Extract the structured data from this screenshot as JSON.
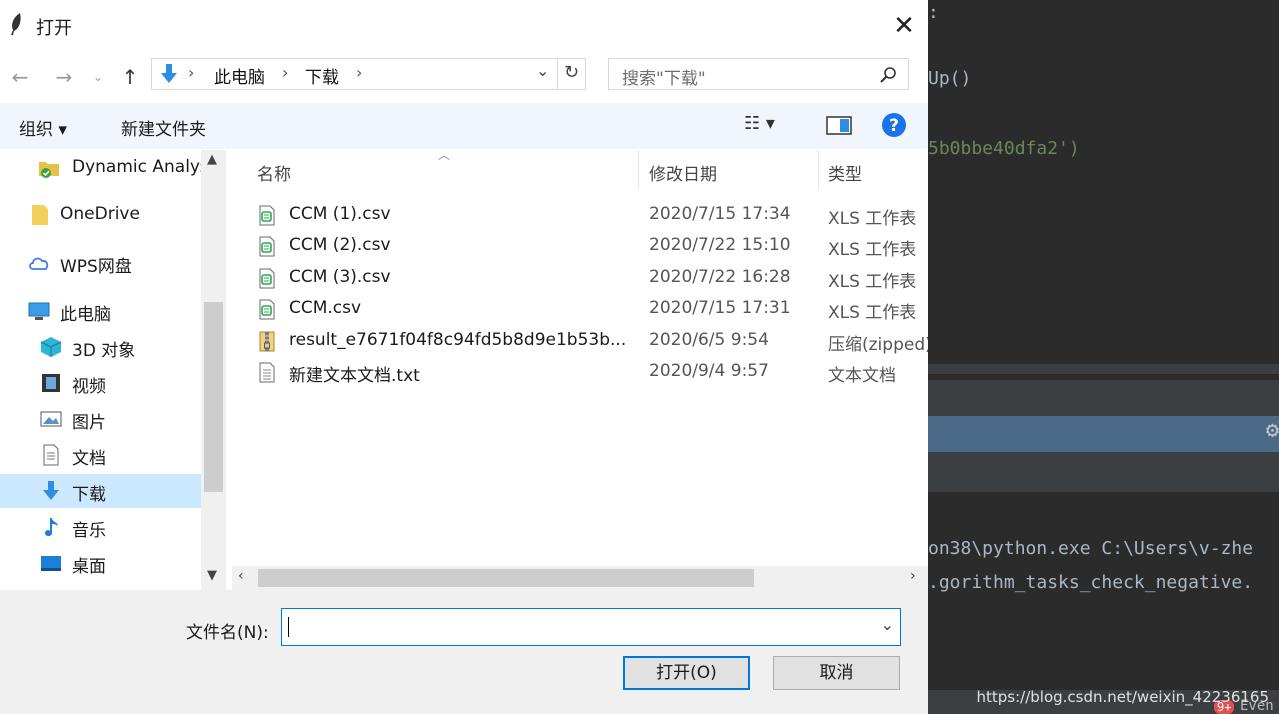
{
  "background_code": {
    "line1": ":",
    "line2": "Up()",
    "line3": "5b0bbe40dfa2')",
    "line4": "on38\\python.exe C:\\Users\\v-zhe",
    "line5": ".gorithm_tasks_check_negative.",
    "badge": "9+",
    "events": "Even"
  },
  "dialog": {
    "title": "打开",
    "address": {
      "root": "此电脑",
      "current": "下载"
    },
    "search_placeholder": "搜索\"下载\"",
    "commands": {
      "organize": "组织 ▾",
      "new_folder": "新建文件夹"
    },
    "nav_items": [
      {
        "label": "Dynamic Analy:",
        "icon": "folder-check-icon"
      },
      {
        "label": "OneDrive",
        "icon": "folder-icon"
      },
      {
        "label": "WPS网盘",
        "icon": "cloud-icon"
      },
      {
        "label": "此电脑",
        "icon": "computer-icon"
      },
      {
        "label": "3D 对象",
        "icon": "cube-icon"
      },
      {
        "label": "视频",
        "icon": "video-icon"
      },
      {
        "label": "图片",
        "icon": "picture-icon"
      },
      {
        "label": "文档",
        "icon": "document-icon"
      },
      {
        "label": "下载",
        "icon": "download-icon"
      },
      {
        "label": "音乐",
        "icon": "music-icon"
      },
      {
        "label": "桌面",
        "icon": "desktop-icon"
      }
    ],
    "columns": {
      "name": "名称",
      "date": "修改日期",
      "type": "类型"
    },
    "files": [
      {
        "name": "CCM (1).csv",
        "date": "2020/7/15 17:34",
        "type": "XLS 工作表",
        "icon": "csv-file-icon"
      },
      {
        "name": "CCM (2).csv",
        "date": "2020/7/22 15:10",
        "type": "XLS 工作表",
        "icon": "csv-file-icon"
      },
      {
        "name": "CCM (3).csv",
        "date": "2020/7/22 16:28",
        "type": "XLS 工作表",
        "icon": "csv-file-icon"
      },
      {
        "name": "CCM.csv",
        "date": "2020/7/15 17:31",
        "type": "XLS 工作表",
        "icon": "csv-file-icon"
      },
      {
        "name": "result_e7671f04f8c94fd5b8d9e1b53b...",
        "date": "2020/6/5 9:54",
        "type": "压缩(zipped)",
        "icon": "zip-file-icon"
      },
      {
        "name": "新建文本文档.txt",
        "date": "2020/9/4 9:57",
        "type": "文本文档",
        "icon": "txt-file-icon"
      }
    ],
    "filename_label": "文件名(N):",
    "filename_value": "",
    "open_button": "打开(O)",
    "cancel_button": "取消"
  },
  "watermark_url": "https://blog.csdn.net/weixin_42236165",
  "colors": {
    "accent": "#0078d7",
    "cmdbar": "#f0f6fc",
    "selected": "#cce8ff",
    "code_bg": "#2b2b2b"
  }
}
